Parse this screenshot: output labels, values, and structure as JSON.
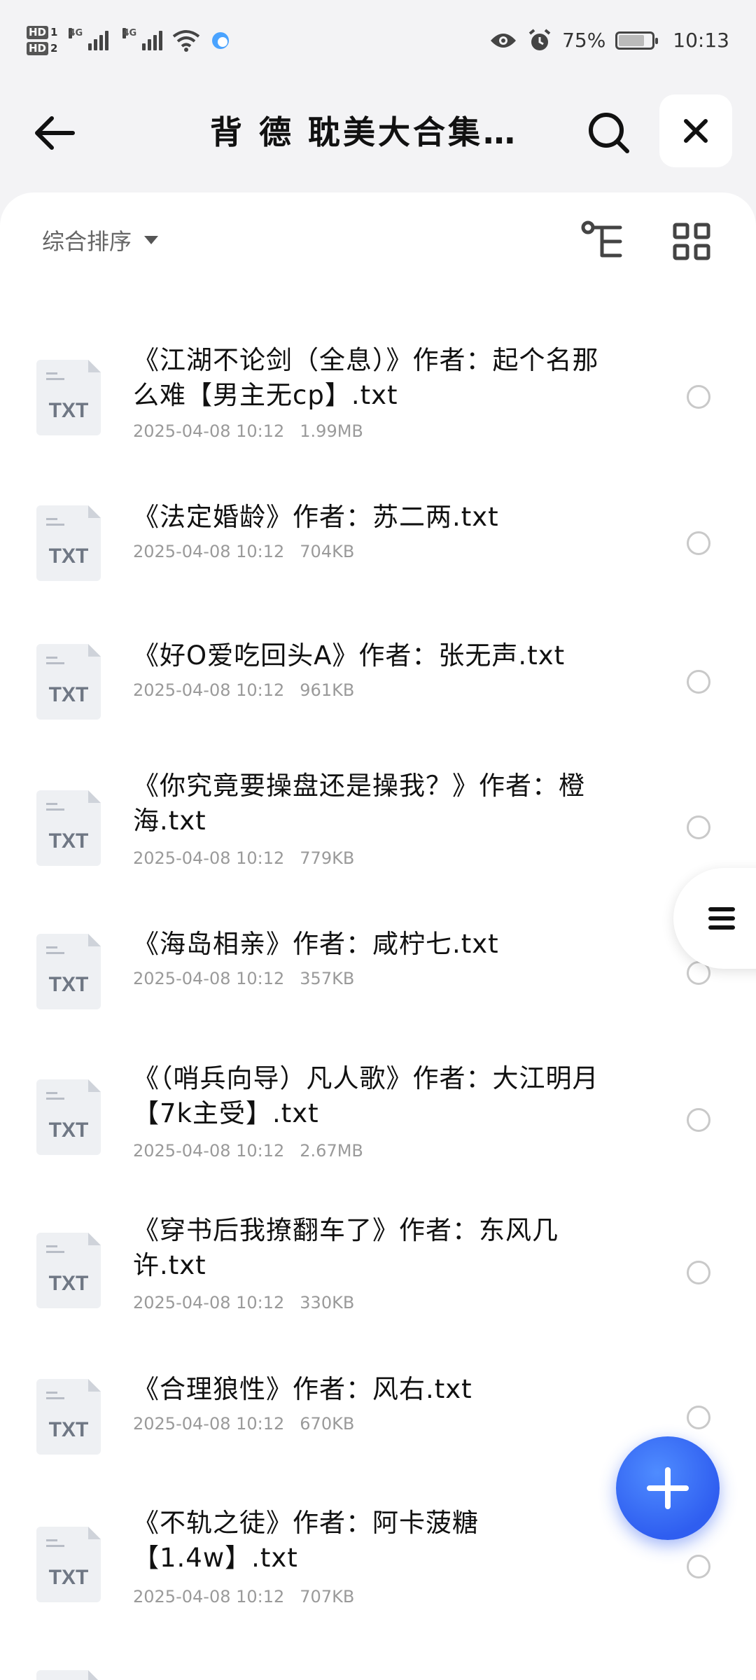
{
  "status_bar": {
    "hd1": "HD",
    "hd1_num": "1",
    "hd2": "HD",
    "hd2_num": "2",
    "net1": "4G",
    "net2": "4G",
    "battery_percent": "75%",
    "time": "10:13"
  },
  "header": {
    "title": "背 德 耽美大合集…"
  },
  "toolbar": {
    "sort_label": "综合排序"
  },
  "files": [
    {
      "name": "《江湖不论剑（全息）》作者：起个名那么难【男主无cp】.txt",
      "date": "2025-04-08 10:12",
      "size": "1.99MB",
      "type": "TXT"
    },
    {
      "name": "《法定婚龄》作者：苏二两.txt",
      "date": "2025-04-08 10:12",
      "size": "704KB",
      "type": "TXT"
    },
    {
      "name": "《好O爱吃回头A》作者：张无声.txt",
      "date": "2025-04-08 10:12",
      "size": "961KB",
      "type": "TXT"
    },
    {
      "name": "《你究竟要操盘还是操我？》作者：橙海.txt",
      "date": "2025-04-08 10:12",
      "size": "779KB",
      "type": "TXT"
    },
    {
      "name": "《海岛相亲》作者：咸柠七.txt",
      "date": "2025-04-08 10:12",
      "size": "357KB",
      "type": "TXT"
    },
    {
      "name": "《（哨兵向导）凡人歌》作者：大江明月【7k主受】.txt",
      "date": "2025-04-08 10:12",
      "size": "2.67MB",
      "type": "TXT"
    },
    {
      "name": "《穿书后我撩翻车了》作者：东风几许.txt",
      "date": "2025-04-08 10:12",
      "size": "330KB",
      "type": "TXT"
    },
    {
      "name": "《合理狼性》作者：风右.txt",
      "date": "2025-04-08 10:12",
      "size": "670KB",
      "type": "TXT"
    },
    {
      "name": "《不轨之徒》作者：阿卡菠糖【1.4w】.txt",
      "date": "2025-04-08 10:12",
      "size": "707KB",
      "type": "TXT"
    }
  ],
  "colors": {
    "accent": "#2f5ef0",
    "background": "#f3f3f5"
  }
}
